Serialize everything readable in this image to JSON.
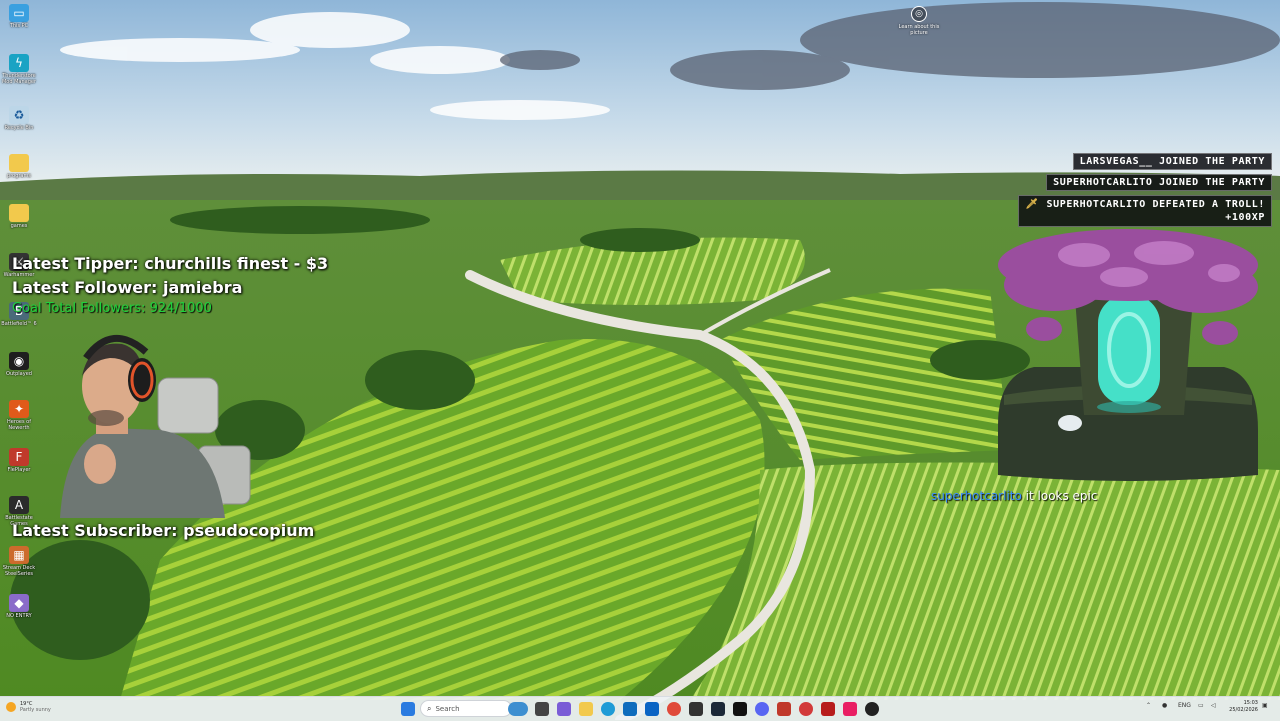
{
  "desktop_icons": [
    {
      "label": "This PC",
      "icon": "monitor-icon",
      "color": "#3aa0e0"
    },
    {
      "label": "Thunderstore Mod Manager",
      "icon": "thunderstore-icon",
      "color": "#1aa3c4"
    },
    {
      "label": "Recycle Bin",
      "icon": "recycle-bin-icon",
      "color": "#bcd6e8"
    },
    {
      "label": "programs",
      "icon": "folder-icon",
      "color": "#f2c94c"
    },
    {
      "label": "games",
      "icon": "folder-icon",
      "color": "#f2c94c"
    },
    {
      "label": "Warhammer",
      "icon": "warhammer-icon",
      "color": "#333333"
    },
    {
      "label": "Battlefield™ 6",
      "icon": "battlefield-icon",
      "color": "#4a6a7a"
    },
    {
      "label": "Outplayed",
      "icon": "outplayed-icon",
      "color": "#1e1e1e"
    },
    {
      "label": "Heroes of Newerth",
      "icon": "heroes-icon",
      "color": "#e05a1a"
    },
    {
      "label": "FlePlayer",
      "icon": "flashplayer-icon",
      "color": "#c0392b"
    },
    {
      "label": "Battlestate Games",
      "icon": "battlestate-icon",
      "color": "#2b2b2b"
    },
    {
      "label": "Stream Deck SteelSeries",
      "icon": "streamdeck-icon",
      "color": "#cc6b2c"
    },
    {
      "label": "NO ENTRY",
      "icon": "game-cover-icon",
      "color": "#8a6bc9"
    }
  ],
  "learn_picture": {
    "label": "Learn about this picture",
    "icon": "camera-icon"
  },
  "overlay": {
    "latest_tipper": "Latest Tipper: churchills finest  - $3",
    "latest_follower": "Latest Follower: jamiebra",
    "follower_goal": "Goal Total Followers: 924/1000",
    "latest_subscriber": "Latest Subscriber: pseudocopium"
  },
  "notifications": [
    {
      "text": "LARSVEGAS__ JOINED THE PARTY"
    },
    {
      "text": "SUPERHOTCARLITO JOINED THE PARTY"
    },
    {
      "text_line1": "SUPERHOTCARLITO DEFEATED A TROLL!",
      "text_line2": "+100XP",
      "icon": "sword-icon"
    }
  ],
  "chat": {
    "user": "superhotcarlito",
    "message": " it looks epic"
  },
  "taskbar": {
    "weather_temp": "19°C",
    "weather_desc": "Partly sunny",
    "search_placeholder": "Search",
    "lang": "ENG",
    "time": "15:03",
    "date": "25/02/2026"
  }
}
